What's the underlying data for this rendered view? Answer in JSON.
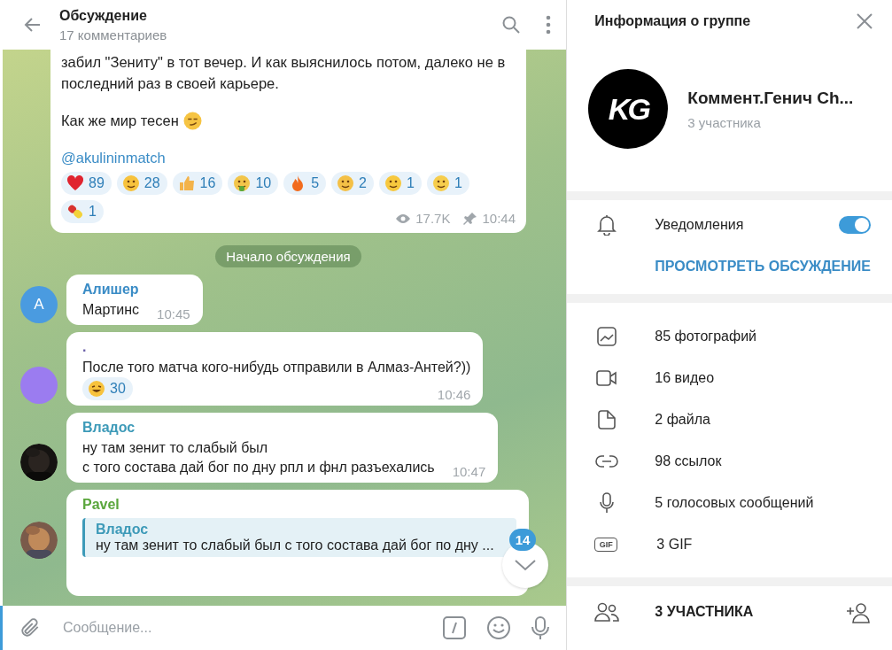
{
  "chat": {
    "title": "Обсуждение",
    "subtitle": "17 комментариев",
    "post": {
      "text": "забил \"Зениту\" в тот вечер. И как выяснилось потом, далеко не в последний раз в своей карьере.",
      "closing": "Как же мир тесен",
      "link": "@akulininmatch",
      "reactions": [
        {
          "kind": "heart",
          "count": "89"
        },
        {
          "kind": "laugh",
          "count": "28"
        },
        {
          "kind": "thumbs",
          "count": "16"
        },
        {
          "kind": "sick",
          "count": "10"
        },
        {
          "kind": "fire",
          "count": "5"
        },
        {
          "kind": "think",
          "count": "2"
        },
        {
          "kind": "starstruck",
          "count": "1"
        },
        {
          "kind": "neutral",
          "count": "1"
        },
        {
          "kind": "pill",
          "count": "1"
        }
      ],
      "views": "17.7K",
      "time": "10:44"
    },
    "service": "Начало обсуждения",
    "messages": [
      {
        "author": "Алишер",
        "color": "#3a8cc6",
        "avatar": {
          "kind": "letter",
          "letter": "А",
          "color": "#4a9be0"
        },
        "text": "Мартинс",
        "time": "10:45"
      },
      {
        "author": ".",
        "color": "#6a5fa8",
        "avatar": {
          "kind": "plain",
          "color": "#9b7cf0"
        },
        "text": "После того матча кого-нибудь отправили в Алмаз-Антей?))",
        "reactions": [
          {
            "kind": "laugh",
            "count": "30"
          }
        ],
        "time": "10:46"
      },
      {
        "author": "Владос",
        "color": "#3d9ab8",
        "text": "ну там зенит то слабый был\nс того состава дай бог по дну рпл и фнл разъехались",
        "time": "10:47"
      },
      {
        "author": "Pavel",
        "color": "#5aa63c",
        "reply": {
          "author": "Владос",
          "text": "ну там зенит то слабый был с того состава дай бог по дну ..."
        }
      }
    ],
    "unread": "14",
    "placeholder": "Сообщение..."
  },
  "info": {
    "title": "Информация о группе",
    "logo": "KG",
    "name": "Коммент.Генич Ch...",
    "members": "3 участника",
    "notifications": {
      "label": "Уведомления",
      "on": true
    },
    "discussion_link": "ПРОСМОТРЕТЬ ОБСУЖДЕНИЕ",
    "media": [
      {
        "label": "85 фотографий"
      },
      {
        "kind": "video",
        "label": "16 видео"
      },
      {
        "kind": "file",
        "label": "2 файла"
      },
      {
        "kind": "link",
        "label": "98 ссылок"
      },
      {
        "kind": "voice",
        "label": "5 голосовых сообщений"
      },
      {
        "kind": "gif",
        "badge": "GIF",
        "label": "3 GIF"
      }
    ],
    "members_title": "3 УЧАСТНИКА"
  }
}
